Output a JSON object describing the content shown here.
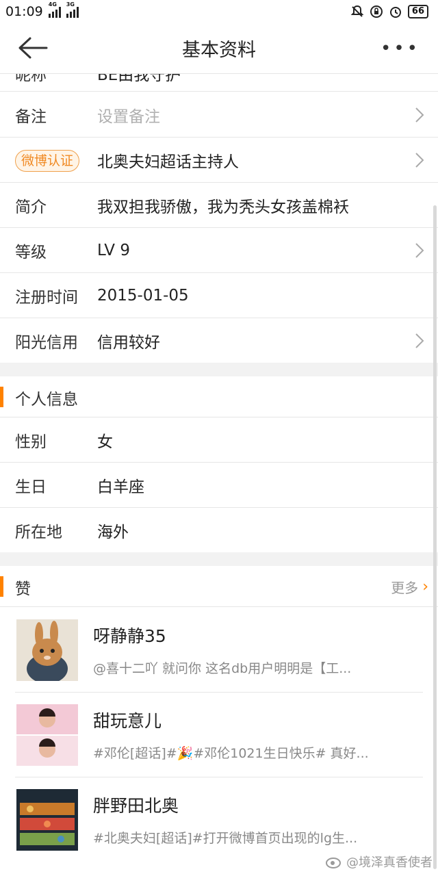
{
  "status_bar": {
    "time": "01:09",
    "net1": "4G",
    "net2": "3G",
    "battery": "66"
  },
  "header": {
    "title": "基本资料"
  },
  "rows": {
    "nickname_label": "昵称",
    "nickname_value": "BE由我守护",
    "remark_label": "备注",
    "remark_placeholder": "设置备注",
    "verify_badge": "微博认证",
    "verify_value": "北奥夫妇超话主持人",
    "bio_label": "简介",
    "bio_value": "我双担我骄傲，我为秃头女孩盖棉袄",
    "level_label": "等级",
    "level_value": "LV 9",
    "register_label": "注册时间",
    "register_value": "2015-01-05",
    "credit_label": "阳光信用",
    "credit_value": "信用较好"
  },
  "personal": {
    "section_title": "个人信息",
    "gender_label": "性别",
    "gender_value": "女",
    "birthday_label": "生日",
    "birthday_value": "白羊座",
    "location_label": "所在地",
    "location_value": "海外"
  },
  "likes": {
    "section_title": "赞",
    "more_label": "更多",
    "items": [
      {
        "name": "呀静静35",
        "snippet": "@喜十二吖 就问你 这名db用户明明是【工..."
      },
      {
        "name": "甜玩意儿",
        "snippet": "#邓伦[超话]#🎉#邓伦1021生日快乐# 真好..."
      },
      {
        "name": "胖野田北奥",
        "snippet": "#北奥夫妇[超话]#打开微博首页出现的lg生..."
      }
    ]
  },
  "watermark": "@境泽真香使者",
  "colors": {
    "accent": "#ff8200",
    "badge_text": "#f08a24",
    "gap": "#f2f2f2"
  }
}
